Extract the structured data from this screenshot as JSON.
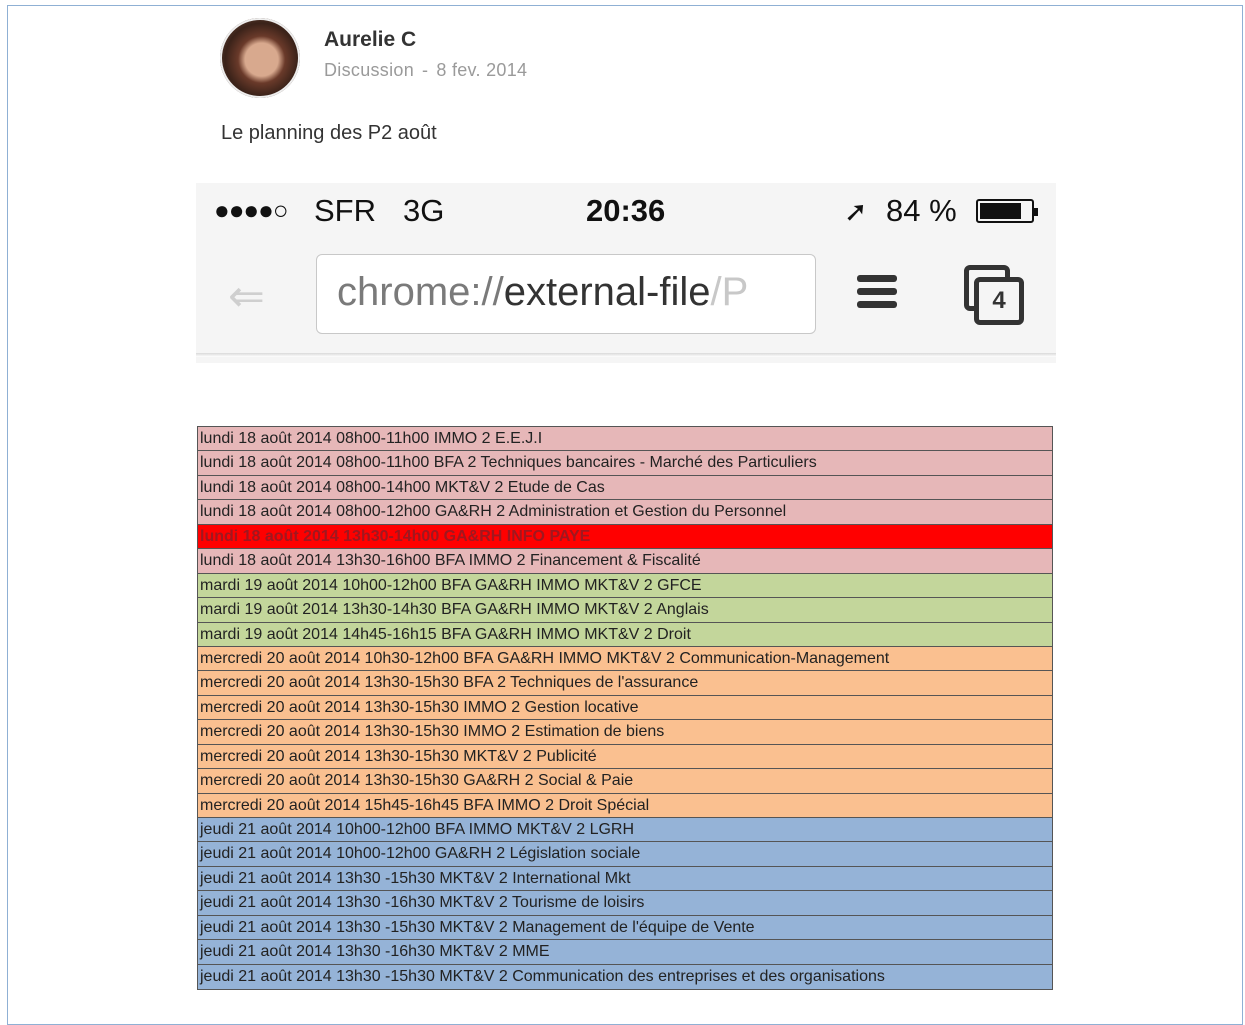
{
  "post": {
    "author": "Aurelie C",
    "category": "Discussion",
    "separator": "-",
    "date": "8 fev. 2014",
    "text": "Le planning des P2 août"
  },
  "phone": {
    "signal": "●●●●○",
    "carrier": "SFR",
    "network": "3G",
    "time": "20:36",
    "location_icon": "location-arrow-icon",
    "battery": "84 %",
    "battery_level": 0.84,
    "url_scheme": "chrome://",
    "url_host": "external-file",
    "url_rest": "/P",
    "tab_count": "4"
  },
  "schedule": {
    "colors": {
      "pink": "#e6b7b8",
      "red": "#ff0000",
      "green": "#c3d69b",
      "orange": "#fac090",
      "blue": "#95b3d7"
    },
    "rows": [
      {
        "text": "lundi 18 août 2014 08h00-11h00 IMMO 2 E.E.J.I",
        "color": "pink"
      },
      {
        "text": "lundi 18 août 2014 08h00-11h00 BFA 2 Techniques bancaires - Marché des Particuliers",
        "color": "pink"
      },
      {
        "text": "lundi 18 août 2014 08h00-14h00 MKT&V 2 Etude de Cas",
        "color": "pink"
      },
      {
        "text": "lundi 18 août 2014 08h00-12h00 GA&RH 2 Administration et Gestion du Personnel",
        "color": "pink"
      },
      {
        "text": "lundi 18 août 2014 13h30-14h00 GA&RH INFO PAYE",
        "color": "red"
      },
      {
        "text": "lundi 18 août 2014 13h30-16h00 BFA IMMO 2 Financement & Fiscalité",
        "color": "pink"
      },
      {
        "text": "mardi 19 août 2014 10h00-12h00 BFA GA&RH IMMO MKT&V 2 GFCE",
        "color": "green"
      },
      {
        "text": "mardi 19 août 2014 13h30-14h30 BFA GA&RH IMMO MKT&V 2 Anglais",
        "color": "green"
      },
      {
        "text": "mardi 19 août 2014 14h45-16h15 BFA GA&RH IMMO MKT&V 2 Droit",
        "color": "green"
      },
      {
        "text": "mercredi 20 août 2014 10h30-12h00 BFA GA&RH IMMO MKT&V 2 Communication-Management",
        "color": "orange"
      },
      {
        "text": "mercredi 20 août 2014 13h30-15h30 BFA 2 Techniques de l'assurance",
        "color": "orange"
      },
      {
        "text": "mercredi 20 août 2014 13h30-15h30 IMMO 2 Gestion locative",
        "color": "orange"
      },
      {
        "text": "mercredi 20 août 2014 13h30-15h30 IMMO 2 Estimation de biens",
        "color": "orange"
      },
      {
        "text": "mercredi 20 août 2014 13h30-15h30 MKT&V 2 Publicité",
        "color": "orange"
      },
      {
        "text": "mercredi 20 août 2014 13h30-15h30 GA&RH 2 Social & Paie",
        "color": "orange"
      },
      {
        "text": "mercredi 20 août 2014 15h45-16h45 BFA IMMO 2 Droit Spécial",
        "color": "orange"
      },
      {
        "text": "jeudi 21 août 2014 10h00-12h00 BFA IMMO MKT&V 2 LGRH",
        "color": "blue"
      },
      {
        "text": "jeudi 21 août 2014 10h00-12h00 GA&RH 2 Législation sociale",
        "color": "blue"
      },
      {
        "text": "jeudi 21 août 2014 13h30 -15h30 MKT&V 2 International Mkt",
        "color": "blue"
      },
      {
        "text": "jeudi 21 août 2014 13h30 -16h30 MKT&V 2 Tourisme de loisirs",
        "color": "blue"
      },
      {
        "text": "jeudi 21 août 2014 13h30 -15h30 MKT&V 2 Management de l'équipe de Vente",
        "color": "blue"
      },
      {
        "text": "jeudi 21 août 2014 13h30 -16h30 MKT&V 2 MME",
        "color": "blue"
      },
      {
        "text": "jeudi 21 août 2014 13h30 -15h30 MKT&V 2 Communication des entreprises et des organisations",
        "color": "blue"
      }
    ]
  }
}
